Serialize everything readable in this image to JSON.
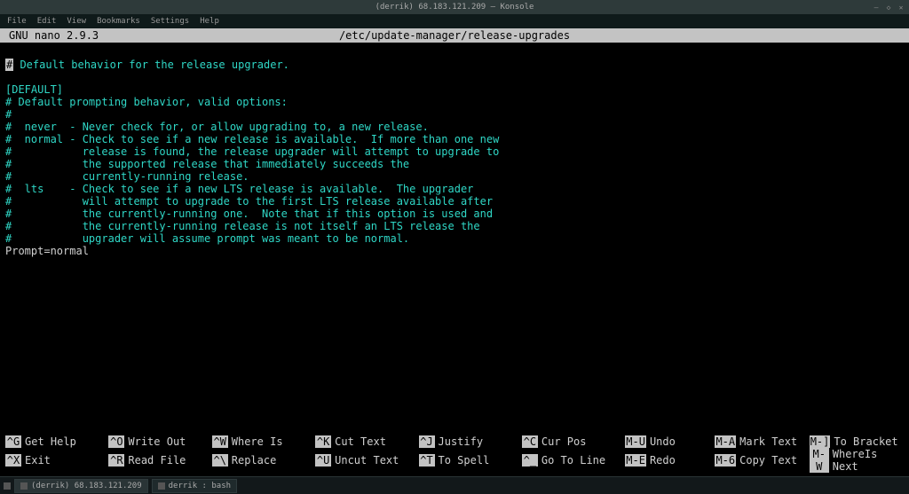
{
  "window": {
    "title": "(derrik) 68.183.121.209 — Konsole"
  },
  "menubar": {
    "items": [
      "File",
      "Edit",
      "View",
      "Bookmarks",
      "Settings",
      "Help"
    ]
  },
  "nano": {
    "version": "GNU nano 2.9.3",
    "filepath": "/etc/update-manager/release-upgrades"
  },
  "content": {
    "l0_highlight": "#",
    "l0_rest": " Default behavior for the release upgrader.",
    "l1": "",
    "l2": "[DEFAULT]",
    "l3": "# Default prompting behavior, valid options:",
    "l4": "#",
    "l5": "#  never  - Never check for, or allow upgrading to, a new release.",
    "l6": "#  normal - Check to see if a new release is available.  If more than one new",
    "l7": "#           release is found, the release upgrader will attempt to upgrade to",
    "l8": "#           the supported release that immediately succeeds the",
    "l9": "#           currently-running release.",
    "l10": "#  lts    - Check to see if a new LTS release is available.  The upgrader",
    "l11": "#           will attempt to upgrade to the first LTS release available after",
    "l12": "#           the currently-running one.  Note that if this option is used and",
    "l13": "#           the currently-running release is not itself an LTS release the",
    "l14": "#           upgrader will assume prompt was meant to be normal.",
    "l15": "Prompt=normal"
  },
  "shortcuts": {
    "row1": [
      {
        "key": "^G",
        "label": "Get Help"
      },
      {
        "key": "^O",
        "label": "Write Out"
      },
      {
        "key": "^W",
        "label": "Where Is"
      },
      {
        "key": "^K",
        "label": "Cut Text"
      },
      {
        "key": "^J",
        "label": "Justify"
      },
      {
        "key": "^C",
        "label": "Cur Pos"
      },
      {
        "key": "M-U",
        "label": "Undo"
      },
      {
        "key": "M-A",
        "label": "Mark Text"
      },
      {
        "key": "M-]",
        "label": "To Bracket"
      }
    ],
    "row2": [
      {
        "key": "^X",
        "label": "Exit"
      },
      {
        "key": "^R",
        "label": "Read File"
      },
      {
        "key": "^\\",
        "label": "Replace"
      },
      {
        "key": "^U",
        "label": "Uncut Text"
      },
      {
        "key": "^T",
        "label": "To Spell"
      },
      {
        "key": "^_",
        "label": "Go To Line"
      },
      {
        "key": "M-E",
        "label": "Redo"
      },
      {
        "key": "M-6",
        "label": "Copy Text"
      },
      {
        "key": "M-W",
        "label": "WhereIs Next"
      }
    ]
  },
  "taskbar": {
    "items": [
      {
        "label": "(derrik) 68.183.121.209",
        "active": true
      },
      {
        "label": "derrik : bash",
        "active": false
      }
    ]
  }
}
